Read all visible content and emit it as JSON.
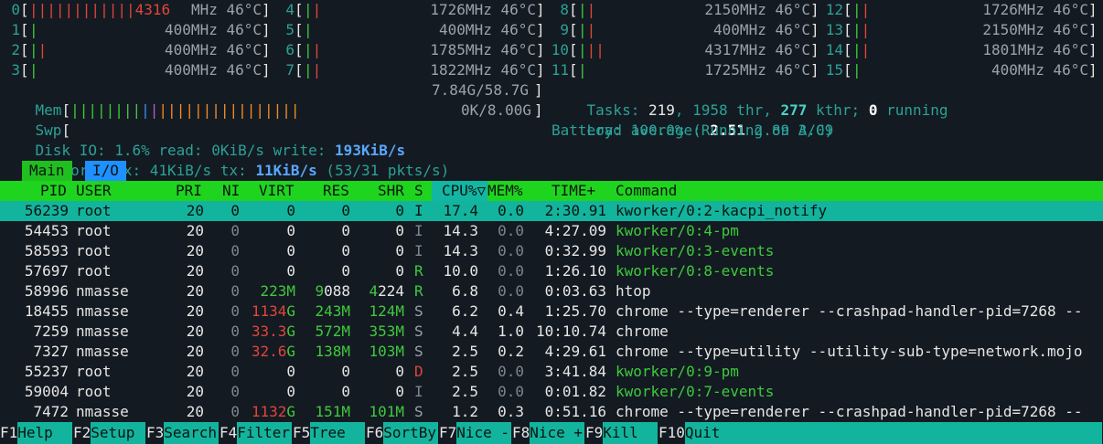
{
  "cpus": [
    {
      "id": "0",
      "bar": "||||||||||||4316",
      "bar_color": "red",
      "freq": "MHz",
      "temp": "46°C"
    },
    {
      "id": "1",
      "bar": "|",
      "freq": "400MHz",
      "temp": "46°C"
    },
    {
      "id": "2",
      "bar": "||",
      "freq": "400MHz",
      "temp": "46°C"
    },
    {
      "id": "3",
      "bar": "|",
      "freq": "400MHz",
      "temp": "46°C"
    },
    {
      "id": "4",
      "bar": "||",
      "freq": "1726MHz",
      "temp": "46°C"
    },
    {
      "id": "5",
      "bar": "|",
      "freq": "400MHz",
      "temp": "46°C"
    },
    {
      "id": "6",
      "bar": "||",
      "freq": "1785MHz",
      "temp": "46°C"
    },
    {
      "id": "7",
      "bar": "||",
      "freq": "1822MHz",
      "temp": "46°C"
    },
    {
      "id": "8",
      "bar": "||",
      "freq": "2150MHz",
      "temp": "46°C"
    },
    {
      "id": "9",
      "bar": "||",
      "freq": "400MHz",
      "temp": "46°C"
    },
    {
      "id": "10",
      "bar": "|||",
      "freq": "4317MHz",
      "temp": "46°C"
    },
    {
      "id": "11",
      "bar": "|",
      "freq": "1725MHz",
      "temp": "46°C"
    },
    {
      "id": "12",
      "bar": "||",
      "freq": "1726MHz",
      "temp": "46°C"
    },
    {
      "id": "13",
      "bar": "||",
      "freq": "2150MHz",
      "temp": "46°C"
    },
    {
      "id": "14",
      "bar": "||",
      "freq": "1801MHz",
      "temp": "46°C"
    },
    {
      "id": "15",
      "bar": "|",
      "freq": "400MHz",
      "temp": "46°C"
    }
  ],
  "mem": {
    "label": "Mem",
    "bar_green": "||||||||",
    "bar_blue": "|",
    "bar_magenta": "|",
    "bar_orange": "||||||||||||||||",
    "value": "7.84G/58.7G"
  },
  "swp": {
    "label": "Swp",
    "value": "0K/8.00G"
  },
  "disk": {
    "prefix": "Disk IO: 1.6% read: 0KiB/s write: ",
    "write": "193KiB/s"
  },
  "network": {
    "prefix": "Network: rx: 41KiB/s tx: ",
    "tx": "11KiB/s",
    "pkts": " (53/31 pkts/s)"
  },
  "tasks": {
    "label": "Tasks: ",
    "tasks": "219",
    "thr": ", 1958 thr, ",
    "kthr": "277",
    "kthr_label": " kthr; ",
    "running": "0",
    "running_label": " running"
  },
  "load": {
    "label": "Load average: ",
    "one": "2.51",
    "five": "2.89",
    "fifteen": "3.09"
  },
  "battery": {
    "text": "Battery: 100.0% (Running on A/C)"
  },
  "tabs": {
    "main": "Main",
    "io": "I/O"
  },
  "columns": {
    "pid": "PID",
    "user": "USER",
    "pri": "PRI",
    "ni": "NI",
    "virt": "VIRT",
    "res": "RES",
    "shr": "SHR",
    "s": "S",
    "cpu": "CPU%▽",
    "mem": "MEM%",
    "time": "TIME+",
    "cmd": "Command"
  },
  "processes": [
    {
      "pid": "56239",
      "user": "root",
      "pri": "20",
      "ni": "0",
      "virt": "0",
      "res": "0",
      "shr": "0",
      "s": "I",
      "cpu": "17.4",
      "mem": "0.0",
      "time": "2:30.91",
      "cmd": "kworker/0:2-kacpi_notify"
    },
    {
      "pid": "54453",
      "user": "root",
      "pri": "20",
      "ni": "0",
      "virt": "0",
      "res": "0",
      "shr": "0",
      "s": "I",
      "cpu": "14.3",
      "mem": "0.0",
      "time": "4:27.09",
      "cmd": "kworker/0:4-pm"
    },
    {
      "pid": "58593",
      "user": "root",
      "pri": "20",
      "ni": "0",
      "virt": "0",
      "res": "0",
      "shr": "0",
      "s": "I",
      "cpu": "14.3",
      "mem": "0.0",
      "time": "0:32.99",
      "cmd": "kworker/0:3-events"
    },
    {
      "pid": "57697",
      "user": "root",
      "pri": "20",
      "ni": "0",
      "virt": "0",
      "res": "0",
      "shr": "0",
      "s": "R",
      "cpu": "10.0",
      "mem": "0.0",
      "time": "1:26.10",
      "cmd": "kworker/0:8-events"
    },
    {
      "pid": "58996",
      "user": "nmasse",
      "pri": "20",
      "ni": "0",
      "virt": "223M",
      "res": "9088",
      "shr": "4224",
      "s": "R",
      "cpu": "6.8",
      "mem": "0.0",
      "time": "0:03.63",
      "cmd": "htop"
    },
    {
      "pid": "18455",
      "user": "nmasse",
      "pri": "20",
      "ni": "0",
      "virt": "1134G",
      "res": "243M",
      "shr": "124M",
      "s": "S",
      "cpu": "6.2",
      "mem": "0.4",
      "time": "1:25.70",
      "cmd": "chrome --type=renderer --crashpad-handler-pid=7268 --"
    },
    {
      "pid": "7259",
      "user": "nmasse",
      "pri": "20",
      "ni": "0",
      "virt": "33.3G",
      "res": "572M",
      "shr": "353M",
      "s": "S",
      "cpu": "4.4",
      "mem": "1.0",
      "time": "10:10.74",
      "cmd": "chrome"
    },
    {
      "pid": "7327",
      "user": "nmasse",
      "pri": "20",
      "ni": "0",
      "virt": "32.6G",
      "res": "138M",
      "shr": "103M",
      "s": "S",
      "cpu": "2.5",
      "mem": "0.2",
      "time": "4:29.61",
      "cmd": "chrome --type=utility --utility-sub-type=network.mojo"
    },
    {
      "pid": "55237",
      "user": "root",
      "pri": "20",
      "ni": "0",
      "virt": "0",
      "res": "0",
      "shr": "0",
      "s": "D",
      "cpu": "2.5",
      "mem": "0.0",
      "time": "3:41.84",
      "cmd": "kworker/0:9-pm"
    },
    {
      "pid": "59004",
      "user": "root",
      "pri": "20",
      "ni": "0",
      "virt": "0",
      "res": "0",
      "shr": "0",
      "s": "I",
      "cpu": "2.5",
      "mem": "0.0",
      "time": "0:01.82",
      "cmd": "kworker/0:7-events"
    },
    {
      "pid": "7472",
      "user": "nmasse",
      "pri": "20",
      "ni": "0",
      "virt": "1132G",
      "res": "151M",
      "shr": "101M",
      "s": "S",
      "cpu": "1.2",
      "mem": "0.3",
      "time": "0:51.16",
      "cmd": "chrome --type=renderer --crashpad-handler-pid=7268 --"
    }
  ],
  "fkeys": [
    {
      "key": "F1",
      "label": "Help"
    },
    {
      "key": "F2",
      "label": "Setup"
    },
    {
      "key": "F3",
      "label": "Search"
    },
    {
      "key": "F4",
      "label": "Filter"
    },
    {
      "key": "F5",
      "label": "Tree"
    },
    {
      "key": "F6",
      "label": "SortBy"
    },
    {
      "key": "F7",
      "label": "Nice -"
    },
    {
      "key": "F8",
      "label": "Nice +"
    },
    {
      "key": "F9",
      "label": "Kill"
    },
    {
      "key": "F10",
      "label": "Quit"
    }
  ],
  "colors": {
    "bg": "#141a21",
    "teal": "#2aa198",
    "header_green": "#1fd41f",
    "selected": "#13b49e",
    "red": "#e0453b",
    "green": "#3ec93e",
    "blue": "#58a8ff"
  }
}
